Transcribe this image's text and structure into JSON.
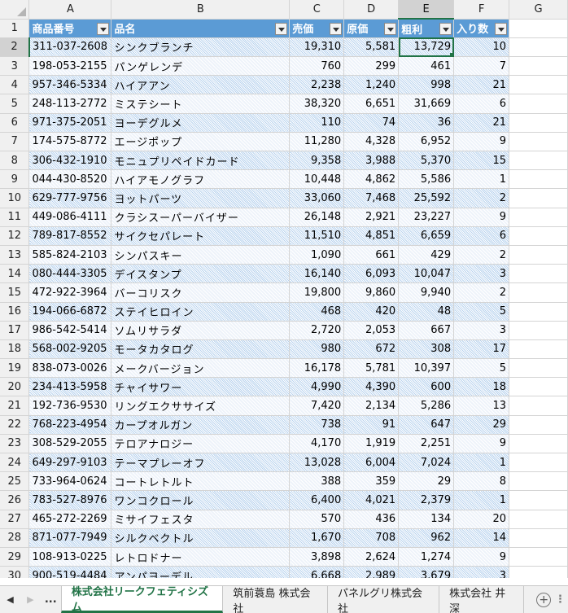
{
  "columns": [
    "A",
    "B",
    "C",
    "D",
    "E",
    "F",
    "G"
  ],
  "selected_column": "E",
  "selected_row": 2,
  "header": {
    "row": 1,
    "cells": [
      "商品番号",
      "品名",
      "売価",
      "原価",
      "粗利",
      "入り数"
    ]
  },
  "rows": [
    {
      "n": 2,
      "code": "311-037-2608",
      "name": "シンクブランチ",
      "price": "19,310",
      "cost": "5,581",
      "profit": "13,729",
      "qty": "10"
    },
    {
      "n": 3,
      "code": "198-053-2155",
      "name": "パンゲレンデ",
      "price": "760",
      "cost": "299",
      "profit": "461",
      "qty": "7"
    },
    {
      "n": 4,
      "code": "957-346-5334",
      "name": "ハイアアン",
      "price": "2,238",
      "cost": "1,240",
      "profit": "998",
      "qty": "21"
    },
    {
      "n": 5,
      "code": "248-113-2772",
      "name": "ミステシート",
      "price": "38,320",
      "cost": "6,651",
      "profit": "31,669",
      "qty": "6"
    },
    {
      "n": 6,
      "code": "971-375-2051",
      "name": "ヨーデグルメ",
      "price": "110",
      "cost": "74",
      "profit": "36",
      "qty": "21"
    },
    {
      "n": 7,
      "code": "174-575-8772",
      "name": "エージポップ",
      "price": "11,280",
      "cost": "4,328",
      "profit": "6,952",
      "qty": "9"
    },
    {
      "n": 8,
      "code": "306-432-1910",
      "name": "モニュプリペイドカード",
      "price": "9,358",
      "cost": "3,988",
      "profit": "5,370",
      "qty": "15"
    },
    {
      "n": 9,
      "code": "044-430-8520",
      "name": "ハイアモノグラフ",
      "price": "10,448",
      "cost": "4,862",
      "profit": "5,586",
      "qty": "1"
    },
    {
      "n": 10,
      "code": "629-777-9756",
      "name": "ヨットパーツ",
      "price": "33,060",
      "cost": "7,468",
      "profit": "25,592",
      "qty": "2"
    },
    {
      "n": 11,
      "code": "449-086-4111",
      "name": "クラシスーパーバイザー",
      "price": "26,148",
      "cost": "2,921",
      "profit": "23,227",
      "qty": "9"
    },
    {
      "n": 12,
      "code": "789-817-8552",
      "name": "サイクセパレート",
      "price": "11,510",
      "cost": "4,851",
      "profit": "6,659",
      "qty": "6"
    },
    {
      "n": 13,
      "code": "585-824-2103",
      "name": "シンパスキー",
      "price": "1,090",
      "cost": "661",
      "profit": "429",
      "qty": "2"
    },
    {
      "n": 14,
      "code": "080-444-3305",
      "name": "デイスタンプ",
      "price": "16,140",
      "cost": "6,093",
      "profit": "10,047",
      "qty": "3"
    },
    {
      "n": 15,
      "code": "472-922-3964",
      "name": "バーコリスク",
      "price": "19,800",
      "cost": "9,860",
      "profit": "9,940",
      "qty": "2"
    },
    {
      "n": 16,
      "code": "194-066-6872",
      "name": "ステイヒロイン",
      "price": "468",
      "cost": "420",
      "profit": "48",
      "qty": "5"
    },
    {
      "n": 17,
      "code": "986-542-5414",
      "name": "ソムリサラダ",
      "price": "2,720",
      "cost": "2,053",
      "profit": "667",
      "qty": "3"
    },
    {
      "n": 18,
      "code": "568-002-9205",
      "name": "モータカタログ",
      "price": "980",
      "cost": "672",
      "profit": "308",
      "qty": "17"
    },
    {
      "n": 19,
      "code": "838-073-0026",
      "name": "メークバージョン",
      "price": "16,178",
      "cost": "5,781",
      "profit": "10,397",
      "qty": "5"
    },
    {
      "n": 20,
      "code": "234-413-5958",
      "name": "チャイサワー",
      "price": "4,990",
      "cost": "4,390",
      "profit": "600",
      "qty": "18"
    },
    {
      "n": 21,
      "code": "192-736-9530",
      "name": "リングエクササイズ",
      "price": "7,420",
      "cost": "2,134",
      "profit": "5,286",
      "qty": "13"
    },
    {
      "n": 22,
      "code": "768-223-4954",
      "name": "カープオルガン",
      "price": "738",
      "cost": "91",
      "profit": "647",
      "qty": "29"
    },
    {
      "n": 23,
      "code": "308-529-2055",
      "name": "テロアナロジー",
      "price": "4,170",
      "cost": "1,919",
      "profit": "2,251",
      "qty": "9"
    },
    {
      "n": 24,
      "code": "649-297-9103",
      "name": "テーマプレーオフ",
      "price": "13,028",
      "cost": "6,004",
      "profit": "7,024",
      "qty": "1"
    },
    {
      "n": 25,
      "code": "733-964-0624",
      "name": "コートレトルト",
      "price": "388",
      "cost": "359",
      "profit": "29",
      "qty": "8"
    },
    {
      "n": 26,
      "code": "783-527-8976",
      "name": "ワンコクロール",
      "price": "6,400",
      "cost": "4,021",
      "profit": "2,379",
      "qty": "1"
    },
    {
      "n": 27,
      "code": "465-272-2269",
      "name": "ミサイフェスタ",
      "price": "570",
      "cost": "436",
      "profit": "134",
      "qty": "20"
    },
    {
      "n": 28,
      "code": "871-077-7949",
      "name": "シルクベクトル",
      "price": "1,670",
      "cost": "708",
      "profit": "962",
      "qty": "14"
    },
    {
      "n": 29,
      "code": "108-913-0225",
      "name": "レトロドナー",
      "price": "3,898",
      "cost": "2,624",
      "profit": "1,274",
      "qty": "9"
    },
    {
      "n": 30,
      "code": "900-519-4484",
      "name": "アンパヨーデル",
      "price": "6,668",
      "cost": "2,989",
      "profit": "3,679",
      "qty": "3"
    }
  ],
  "tabs": {
    "ellipsis": "...",
    "items": [
      "株式会社リークフェティシズム",
      "筑前蓑島 株式会社",
      "パネルグリ株式会社",
      "株式会社 井深"
    ],
    "active_index": 0,
    "add_symbol": "+",
    "more_symbol": "⋮"
  }
}
